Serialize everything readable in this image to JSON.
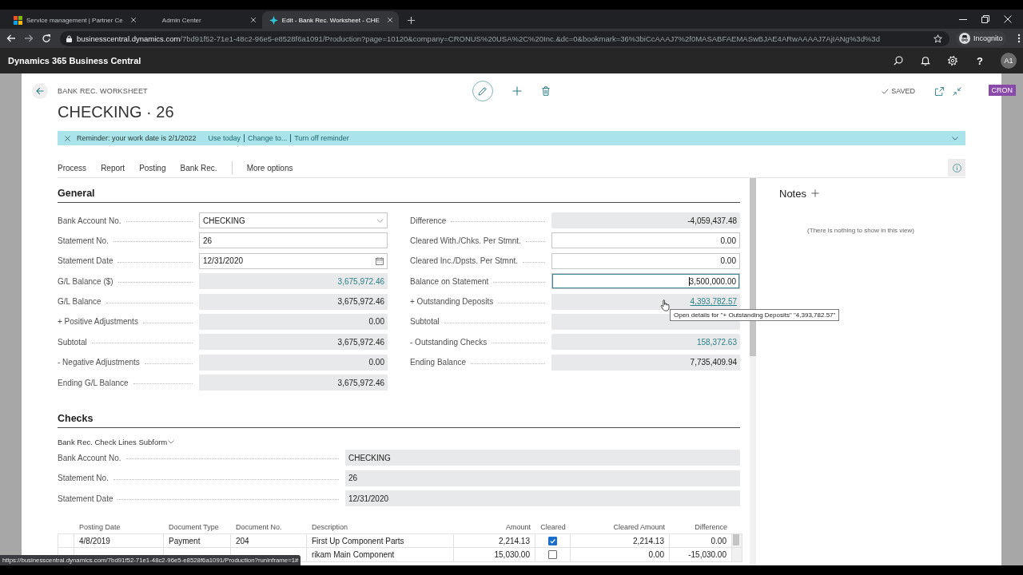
{
  "browser": {
    "tabs": [
      {
        "title": "Service management | Partner Ce",
        "selected": false
      },
      {
        "title": "Admin Center",
        "selected": false
      },
      {
        "title": "Edit - Bank Rec. Worksheet - CHE",
        "selected": true
      }
    ],
    "url": {
      "host": "businesscentral.dynamics.com",
      "path": "/7bd91f52-71e1-48c2-96e5-e8528f6a1091/Production?page=10120&company=CRONUS%20USA%2C%20Inc.&dc=0&bookmark=36%3biCcAAAJ7%2f0MASABFAEMASwBJAE4ARwAAAAJ7AjIANg%3d%3d"
    },
    "profile": "Incognito",
    "status_url": "https://businesscentral.dynamics.com/7bd91f52-71e1-48c2-96e5-e8528f6a1091/Production?runinframe=1#"
  },
  "app_bar": {
    "title": "Dynamics 365 Business Central",
    "help": "?",
    "avatar": "A1"
  },
  "company_badge": "CRON",
  "page": {
    "caption": "BANK REC. WORKSHEET",
    "title": "CHECKING · 26",
    "status": "SAVED",
    "reminder": {
      "text": "Reminder: your work date is 2/1/2022",
      "links": [
        "Use today",
        "Change to...",
        "Turn off reminder"
      ]
    },
    "actions": [
      "Process",
      "Report",
      "Posting",
      "Bank Rec."
    ],
    "more_options": "More options"
  },
  "general": {
    "heading": "General",
    "columns": [
      [
        {
          "label": "Bank Account No.",
          "kind": "dropdown",
          "value": "CHECKING",
          "link": false,
          "focused": false,
          "hovered": false
        },
        {
          "label": "Statement No.",
          "kind": "text",
          "value": "26",
          "link": false,
          "focused": false,
          "hovered": false
        },
        {
          "label": "Statement Date",
          "kind": "date",
          "value": "12/31/2020",
          "link": false,
          "focused": false,
          "hovered": false
        },
        {
          "label": "G/L Balance ($)",
          "kind": "amount",
          "value": "3,675,972.46",
          "link": true,
          "focused": false,
          "hovered": false
        },
        {
          "label": "G/L Balance",
          "kind": "amount",
          "value": "3,675,972.46",
          "link": false,
          "focused": false,
          "hovered": false
        },
        {
          "label": "+ Positive Adjustments",
          "kind": "amount",
          "value": "0.00",
          "link": false,
          "focused": false,
          "hovered": false
        },
        {
          "label": "Subtotal",
          "kind": "amount",
          "value": "3,675,972.46",
          "link": false,
          "focused": false,
          "hovered": false
        },
        {
          "label": "- Negative Adjustments",
          "kind": "amount",
          "value": "0.00",
          "link": false,
          "focused": false,
          "hovered": false
        },
        {
          "label": "Ending G/L Balance",
          "kind": "amount",
          "value": "3,675,972.46",
          "link": false,
          "focused": false,
          "hovered": false
        }
      ],
      [
        {
          "label": "Difference",
          "kind": "amount",
          "value": "-4,059,437.48",
          "link": false,
          "focused": false,
          "hovered": false
        },
        {
          "label": "Cleared With./Chks. Per Stmnt.",
          "kind": "amount_input",
          "value": "0.00",
          "link": false,
          "focused": false,
          "hovered": false
        },
        {
          "label": "Cleared Inc./Dpsts. Per Stmnt.",
          "kind": "amount_input",
          "value": "0.00",
          "link": false,
          "focused": false,
          "hovered": false
        },
        {
          "label": "Balance on Statement",
          "kind": "amount_input",
          "value": "3,500,000.00",
          "link": false,
          "focused": true,
          "hovered": false
        },
        {
          "label": "+ Outstanding Deposits",
          "kind": "amount",
          "value": "4,393,782.57",
          "link": true,
          "focused": false,
          "hovered": true,
          "tooltip": "Open details for \"+ Outstanding Deposits\" \"4,393,782.57\""
        },
        {
          "label": "Subtotal",
          "kind": "amount",
          "focused": false,
          "hovered": false
        },
        {
          "label": "- Outstanding Checks",
          "kind": "amount",
          "value": "158,372.63",
          "link": true,
          "focused": false,
          "hovered": false
        },
        {
          "label": "Ending Balance",
          "kind": "amount",
          "value": "7,735,409.94",
          "link": false,
          "focused": false,
          "hovered": false
        }
      ]
    ]
  },
  "checks": {
    "heading": "Checks",
    "subform": "Bank Rec. Check Lines Subform",
    "fields": [
      {
        "label": "Bank Account No.",
        "kind": "display",
        "value": "CHECKING"
      },
      {
        "label": "Statement No.",
        "kind": "display",
        "value": "26"
      },
      {
        "label": "Statement Date",
        "kind": "display",
        "value": "12/31/2020"
      }
    ],
    "table": {
      "columns": [
        {
          "label": "Posting Date",
          "kind": "text"
        },
        {
          "label": "Document Type",
          "kind": "text"
        },
        {
          "label": "Document No.",
          "kind": "text"
        },
        {
          "label": "Description",
          "kind": "text"
        },
        {
          "label": "Amount",
          "kind": "amount"
        },
        {
          "label": "Cleared",
          "kind": "check"
        },
        {
          "label": "Cleared Amount",
          "kind": "amount"
        },
        {
          "label": "Difference",
          "kind": "amount"
        }
      ],
      "rows": [
        {
          "posting_date": "4/8/2019",
          "document_type": "Payment",
          "document_no": "204",
          "description": "First Up Component Parts",
          "amount": "2,214.13",
          "cleared": true,
          "cleared_amount": "2,214.13",
          "difference": "0.00"
        },
        {
          "description": "rikam Main Component",
          "amount": "15,030.00",
          "cleared": false,
          "cleared_amount": "0.00",
          "difference": "-15,030.00"
        }
      ]
    }
  },
  "notes": {
    "heading": "Notes",
    "empty_text": "(There is nothing to show in this view)"
  }
}
